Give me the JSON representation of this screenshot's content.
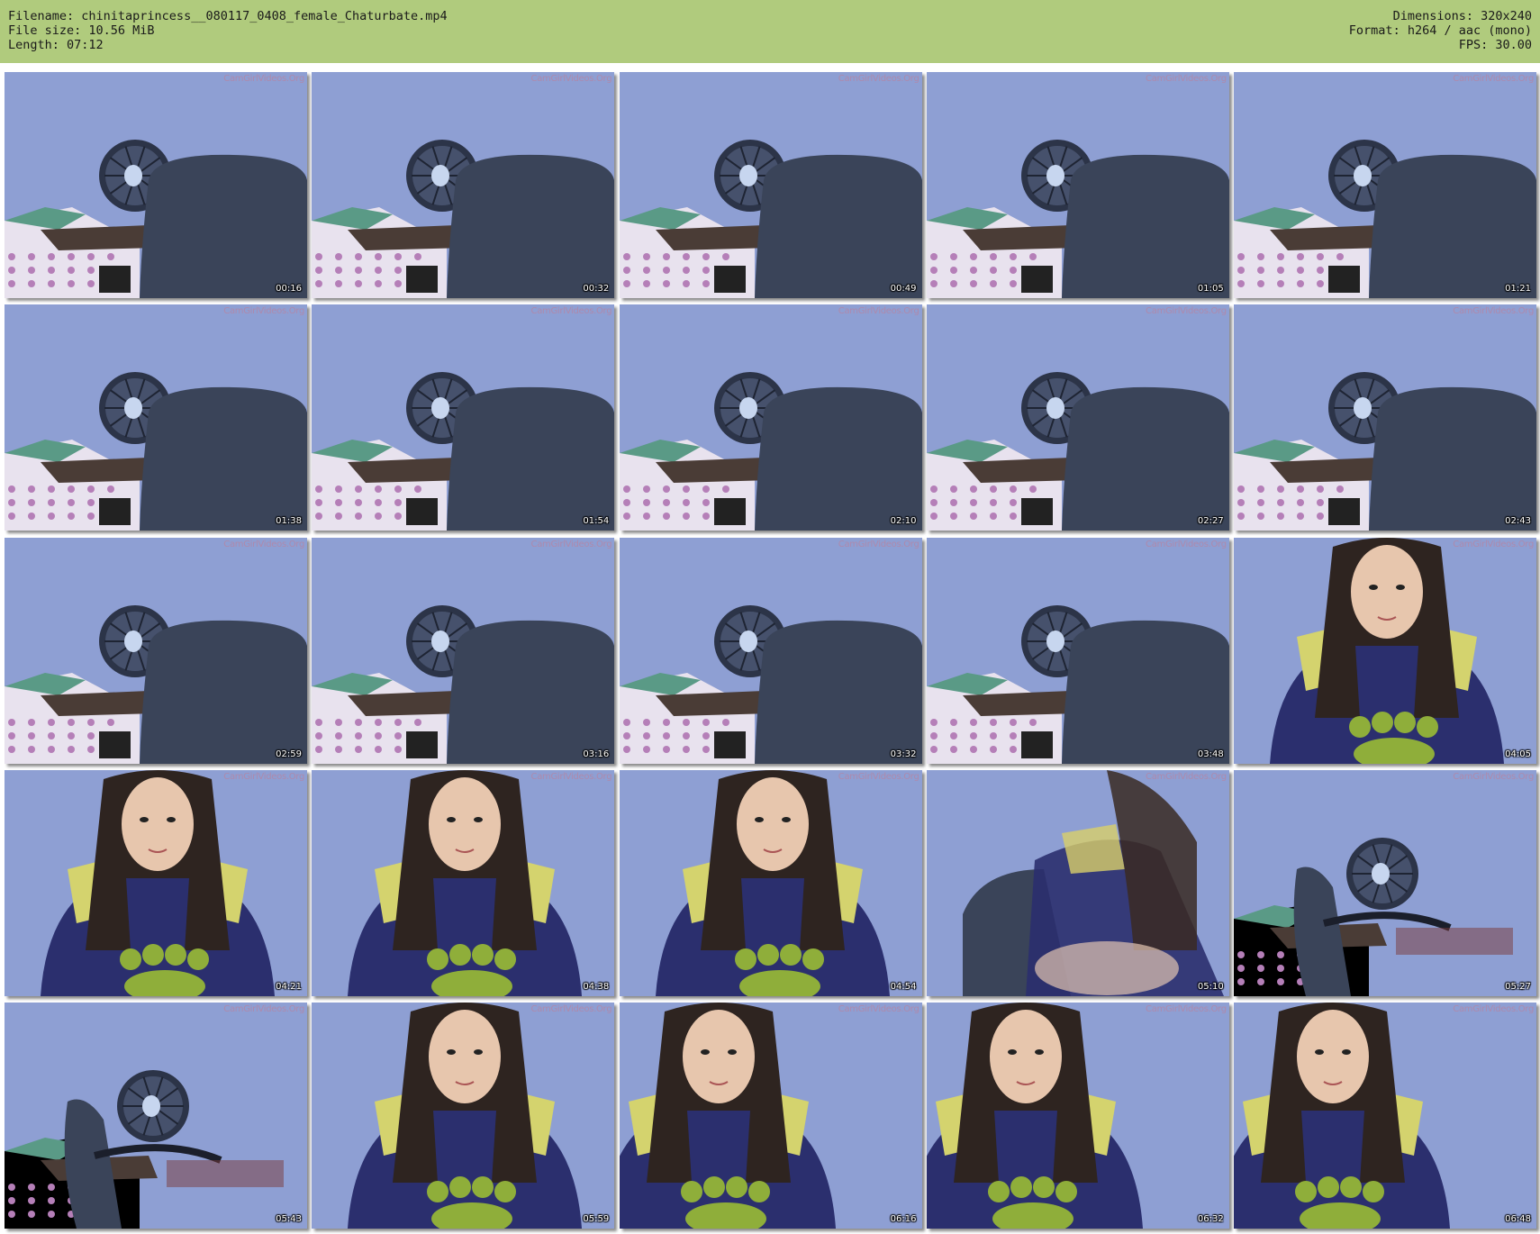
{
  "header": {
    "filename": "Filename: chinitaprincess__080117_0408_female_Chaturbate.mp4",
    "filesize": "File size: 10.56 MiB",
    "length": "Length: 07:12",
    "dimensions": "Dimensions: 320x240",
    "format": "Format: h264 / aac (mono)",
    "fps": "FPS: 30.00"
  },
  "watermark": "CamGirlVideos.Org",
  "colors": {
    "header_bg": "#b0cb7d",
    "wall": "#8e9fd3",
    "chair": "#3a4459",
    "shirt": "#2b2f6e",
    "shirt_print": "#8fae3a"
  },
  "thumbnails": [
    {
      "time": "00:16",
      "scene": "empty"
    },
    {
      "time": "00:32",
      "scene": "empty"
    },
    {
      "time": "00:49",
      "scene": "empty"
    },
    {
      "time": "01:05",
      "scene": "empty"
    },
    {
      "time": "01:21",
      "scene": "empty"
    },
    {
      "time": "01:38",
      "scene": "empty"
    },
    {
      "time": "01:54",
      "scene": "empty"
    },
    {
      "time": "02:10",
      "scene": "empty"
    },
    {
      "time": "02:27",
      "scene": "empty"
    },
    {
      "time": "02:43",
      "scene": "empty"
    },
    {
      "time": "02:59",
      "scene": "empty"
    },
    {
      "time": "03:16",
      "scene": "empty"
    },
    {
      "time": "03:32",
      "scene": "empty"
    },
    {
      "time": "03:48",
      "scene": "empty"
    },
    {
      "time": "04:05",
      "scene": "person"
    },
    {
      "time": "04:21",
      "scene": "person"
    },
    {
      "time": "04:38",
      "scene": "person"
    },
    {
      "time": "04:54",
      "scene": "person"
    },
    {
      "time": "05:10",
      "scene": "blur"
    },
    {
      "time": "05:27",
      "scene": "chair"
    },
    {
      "time": "05:43",
      "scene": "chair"
    },
    {
      "time": "05:59",
      "scene": "person"
    },
    {
      "time": "06:16",
      "scene": "person-side"
    },
    {
      "time": "06:32",
      "scene": "person-side"
    },
    {
      "time": "06:48",
      "scene": "person-side"
    }
  ]
}
